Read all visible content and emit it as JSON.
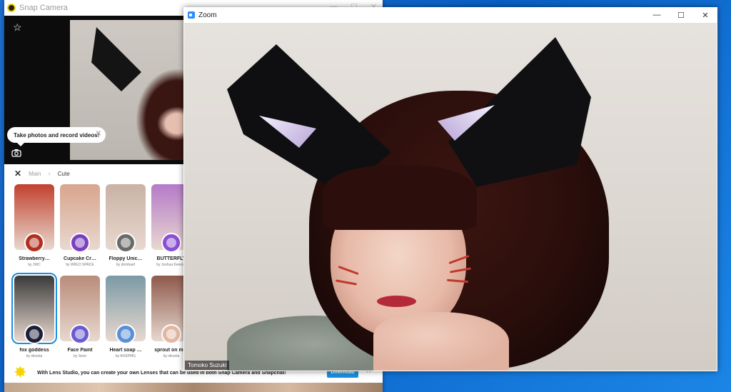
{
  "snap_camera": {
    "title": "Snap Camera",
    "tooltip": "Take photos and record videos!",
    "breadcrumb": {
      "root": "Main",
      "current": "Cute"
    },
    "lenses": [
      {
        "name": "Strawberry…",
        "author": "by JWC",
        "thumb": "#c2412e",
        "badge": "#b0301f"
      },
      {
        "name": "Cupcake Cr…",
        "author": "by WRLD SPACE",
        "thumb": "#d8a58e",
        "badge": "#7a3fbf"
      },
      {
        "name": "Floppy Unic…",
        "author": "by dombaef",
        "thumb": "#c9b2a4",
        "badge": "#6a6a6a"
      },
      {
        "name": "BUTTERFLY",
        "author": "by Joshua Keenan",
        "thumb": "#b57ac9",
        "badge": "#8a4fd3"
      },
      {
        "name": "fox goddess",
        "author": "by nikoola",
        "thumb": "#3a3a3a",
        "badge": "#1d1f3a"
      },
      {
        "name": "Face Paint",
        "author": "by Seve",
        "thumb": "#b98c7a",
        "badge": "#6b5bd0"
      },
      {
        "name": "Heart soap …",
        "author": "by AOEPMG",
        "thumb": "#7a9aa6",
        "badge": "#5a8fd6"
      },
      {
        "name": "sprout on m…",
        "author": "by nikoola",
        "thumb": "#8e5a4c",
        "badge": "#e0b8a2"
      }
    ],
    "banner": {
      "text": "With Lens Studio, you can create your own Lenses that can be used in both Snap Camera and Snapchat!",
      "download_label": "Download"
    }
  },
  "zoom": {
    "title": "Zoom",
    "participant_name": "Tomoko Suzuki"
  },
  "colors": {
    "zoom_blue": "#2d8cff",
    "snap_yellow": "#f4d500",
    "selected_blue": "#1a8fe0"
  }
}
